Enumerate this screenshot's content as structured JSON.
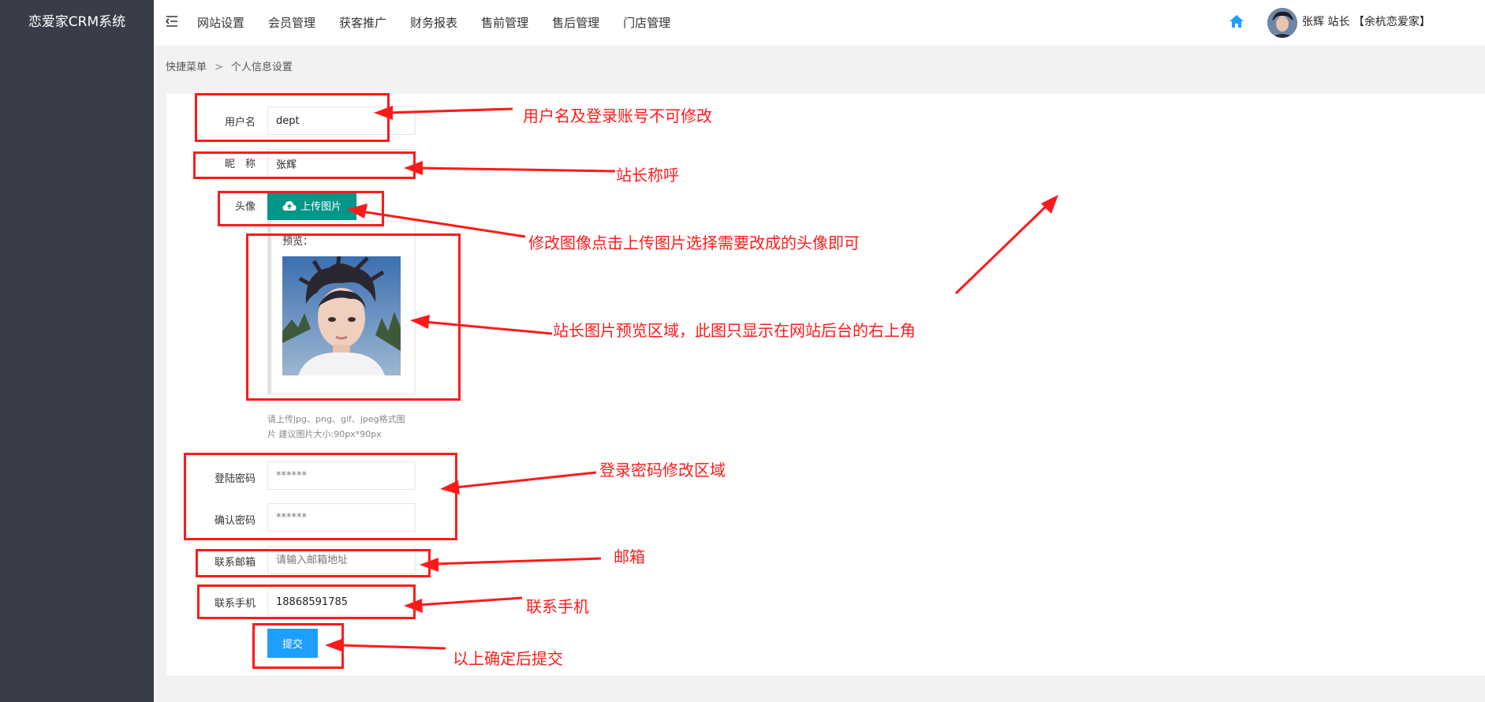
{
  "app": {
    "title": "恋爱家CRM系统"
  },
  "nav": {
    "items": [
      "网站设置",
      "会员管理",
      "获客推广",
      "财务报表",
      "售前管理",
      "售后管理",
      "门店管理"
    ]
  },
  "user": {
    "name": "张辉",
    "role": "站长",
    "store": "【余杭恋爱家】"
  },
  "breadcrumb": {
    "root": "快捷菜单",
    "separator": ">",
    "current": "个人信息设置"
  },
  "form": {
    "username_label": "用户名",
    "username_value": "dept",
    "nickname_label": "昵　称",
    "nickname_value": "张辉",
    "avatar_label": "头像",
    "upload_label": "上传图片",
    "preview_label": "预览：",
    "hint_line1": "请上传jpg、png、gif、jpeg格式图",
    "hint_line2": "片 建议图片大小:90px*90px",
    "password_label": "登陆密码",
    "password_value": "******",
    "confirm_label": "确认密码",
    "confirm_value": "******",
    "email_label": "联系邮箱",
    "email_placeholder": "请输入邮箱地址",
    "phone_label": "联系手机",
    "phone_value": "18868591785",
    "submit_label": "提交"
  },
  "annotations": {
    "username": "用户名及登录账号不可修改",
    "nickname": "站长称呼",
    "avatar": "修改图像点击上传图片选择需要改成的头像即可",
    "preview": "站长图片预览区域，此图只显示在网站后台的右上角",
    "password": "登录密码修改区域",
    "email": "邮箱",
    "phone": "联系手机",
    "submit": "以上确定后提交"
  },
  "colors": {
    "sidebar": "#393d49",
    "upload": "#009688",
    "submit": "#1e9fff",
    "annotation": "#ff1a1a"
  },
  "icons": {
    "menu": "menu-fold-icon",
    "home": "home-icon",
    "upload": "cloud-upload-icon"
  }
}
